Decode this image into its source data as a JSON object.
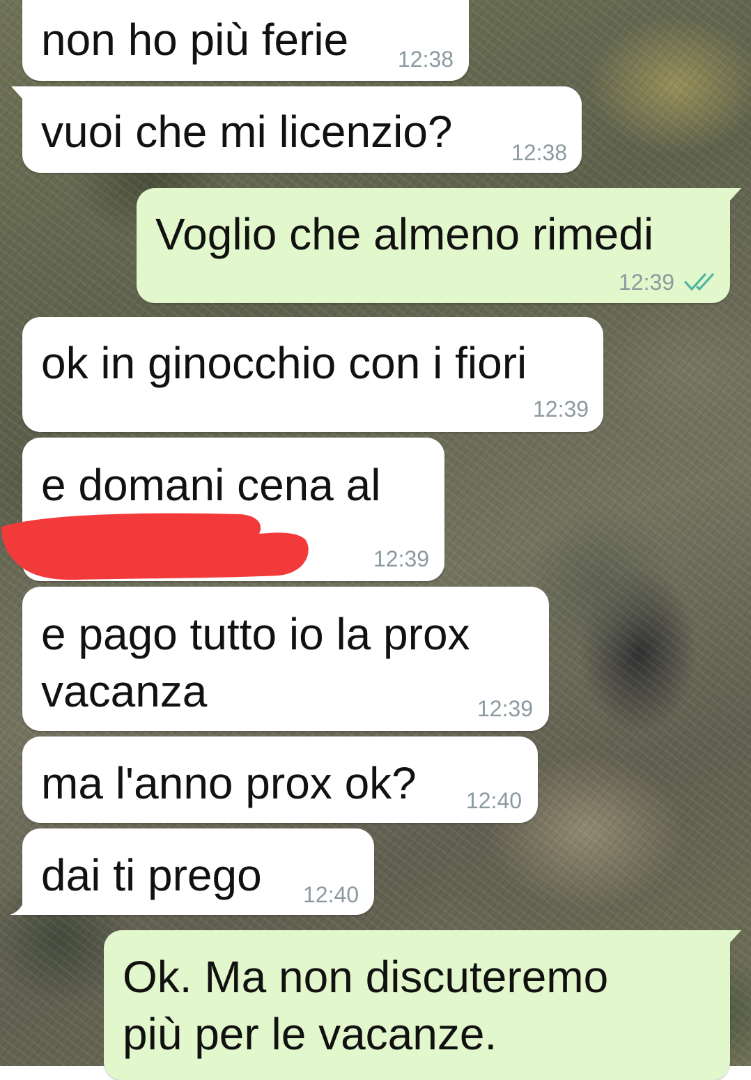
{
  "chat": {
    "messages": [
      {
        "direction": "incoming",
        "lines": [
          "non ho più ferie"
        ],
        "time": "12:38"
      },
      {
        "direction": "incoming",
        "lines": [
          "vuoi che mi licenzio?"
        ],
        "time": "12:38"
      },
      {
        "direction": "outgoing",
        "lines": [
          "Voglio che almeno rimedi"
        ],
        "time": "12:39",
        "status_icon": "double-check-icon"
      },
      {
        "direction": "incoming",
        "lines": [
          "ok in ginocchio con i fiori"
        ],
        "time": "12:39"
      },
      {
        "direction": "incoming",
        "lines": [
          "e domani cena al"
        ],
        "time": "12:39",
        "redacted": true
      },
      {
        "direction": "incoming",
        "lines": [
          "e pago tutto io la prox",
          "vacanza"
        ],
        "time": "12:39"
      },
      {
        "direction": "incoming",
        "lines": [
          "ma l'anno prox ok?"
        ],
        "time": "12:40"
      },
      {
        "direction": "incoming",
        "lines": [
          "dai ti prego"
        ],
        "time": "12:40"
      },
      {
        "direction": "outgoing",
        "lines": [
          "Ok. Ma non discuteremo",
          "più per le vacanze."
        ]
      }
    ]
  },
  "colors": {
    "incoming_bubble": "#ffffff",
    "outgoing_bubble": "#e2f7cb",
    "timestamp": "#8c9aa0",
    "read_ticks": "#4fb6a3",
    "redaction": "#f23a3a"
  }
}
